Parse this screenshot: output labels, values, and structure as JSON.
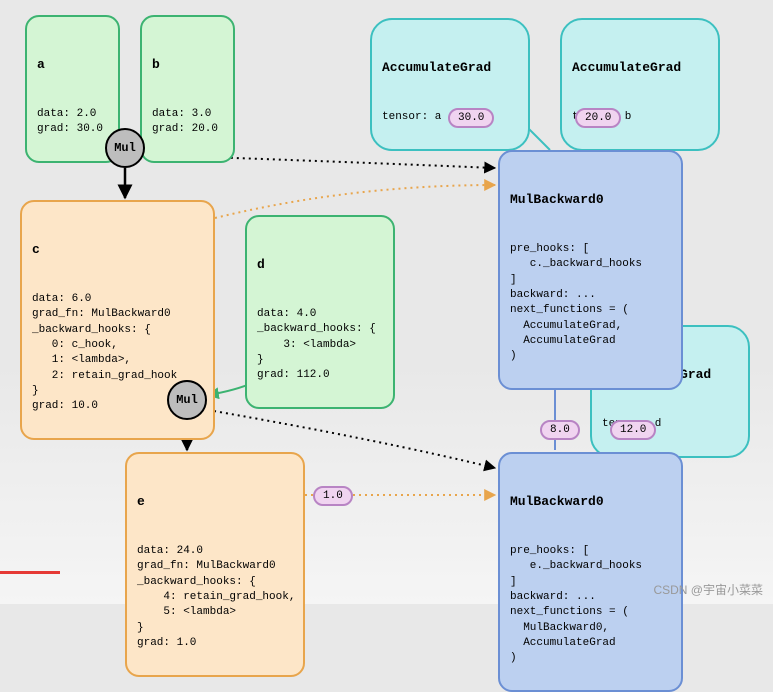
{
  "nodes": {
    "a": {
      "name": "a",
      "body": "data: 2.0\ngrad: 30.0"
    },
    "b": {
      "name": "b",
      "body": "data: 3.0\ngrad: 20.0"
    },
    "c": {
      "name": "c",
      "body": "data: 6.0\ngrad_fn: MulBackward0\n_backward_hooks: {\n   0: c_hook,\n   1: <lambda>,\n   2: retain_grad_hook\n}\ngrad: 10.0"
    },
    "d": {
      "name": "d",
      "body": "data: 4.0\n_backward_hooks: {\n    3: <lambda>\n}\ngrad: 112.0"
    },
    "e": {
      "name": "e",
      "body": "data: 24.0\ngrad_fn: MulBackward0\n_backward_hooks: {\n    4: retain_grad_hook,\n    5: <lambda>\n}\ngrad: 1.0"
    },
    "mulbw1": {
      "title": "MulBackward0",
      "body": "pre_hooks: [\n   c._backward_hooks\n]\nbackward: ...\nnext_functions = (\n  AccumulateGrad,\n  AccumulateGrad\n)"
    },
    "mulbw2": {
      "title": "MulBackward0",
      "body": "pre_hooks: [\n   e._backward_hooks\n]\nbackward: ...\nnext_functions = (\n  MulBackward0,\n  AccumulateGrad\n)"
    },
    "acc_a": {
      "title": "AccumulateGrad",
      "body": "tensor: a"
    },
    "acc_b": {
      "title": "AccumulateGrad",
      "body": "tensor: b"
    },
    "acc_d": {
      "title": "AccumulateGrad",
      "body": "tensor: d"
    }
  },
  "ops": {
    "mul1": "Mul",
    "mul2": "Mul"
  },
  "pills": {
    "p30": "30.0",
    "p20": "20.0",
    "p8": "8.0",
    "p12": "12.0",
    "p1": "1.0"
  },
  "watermark": "CSDN @宇宙小菜菜"
}
